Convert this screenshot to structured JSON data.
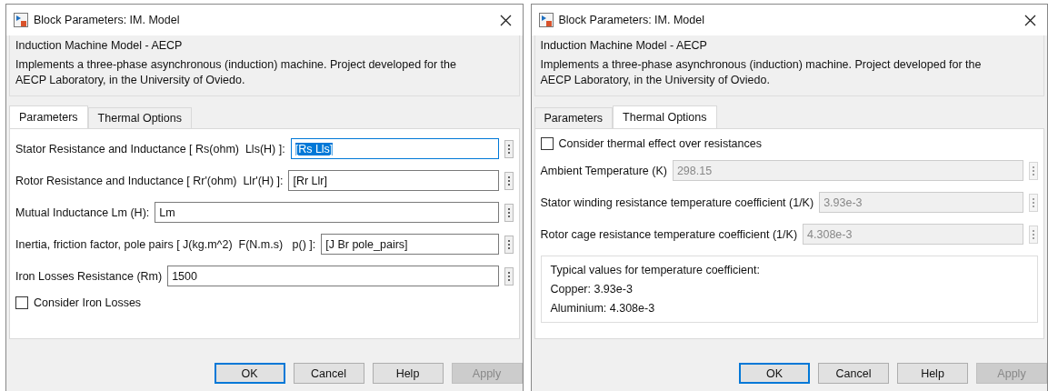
{
  "dialogs": [
    {
      "title": "Block Parameters: IM. Model",
      "group_title": "Induction Machine Model - AECP",
      "description": "Implements a three-phase asynchronous (induction) machine. Project developed for the AECP Laboratory, in the University of Oviedo.",
      "tabs": [
        {
          "label": "Parameters",
          "selected": true
        },
        {
          "label": "Thermal Options",
          "selected": false
        }
      ],
      "items": [
        {
          "kind": "field",
          "label": "Stator Resistance and Inductance [ Rs(ohm)  Lls(H) ]:",
          "value": "[Rs Lls]",
          "disabled": false,
          "focused": true
        },
        {
          "kind": "field",
          "label": "Rotor Resistance and Inductance [ Rr'(ohm)  Llr'(H) ]:",
          "value": "[Rr Llr]",
          "disabled": false,
          "focused": false
        },
        {
          "kind": "field",
          "label": "Mutual Inductance Lm (H):",
          "value": "Lm",
          "disabled": false,
          "focused": false
        },
        {
          "kind": "field",
          "label": "Inertia, friction factor, pole pairs [ J(kg.m^2)  F(N.m.s)   p() ]:",
          "value": "[J Br pole_pairs]",
          "disabled": false,
          "focused": false
        },
        {
          "kind": "field",
          "label": "Iron Losses Resistance (Rm)",
          "value": "1500",
          "disabled": false,
          "focused": false
        },
        {
          "kind": "checkbox",
          "label": "Consider Iron Losses",
          "checked": false
        }
      ],
      "buttons": [
        {
          "label": "OK",
          "disabled": false,
          "default": true
        },
        {
          "label": "Cancel",
          "disabled": false,
          "default": false
        },
        {
          "label": "Help",
          "disabled": false,
          "default": false
        },
        {
          "label": "Apply",
          "disabled": true,
          "default": false
        }
      ]
    },
    {
      "title": "Block Parameters: IM. Model",
      "group_title": "Induction Machine Model - AECP",
      "description": "Implements a three-phase asynchronous (induction) machine. Project developed for the AECP Laboratory, in the University of Oviedo.",
      "tabs": [
        {
          "label": "Parameters",
          "selected": false
        },
        {
          "label": "Thermal Options",
          "selected": true
        }
      ],
      "items": [
        {
          "kind": "checkbox",
          "label": "Consider thermal effect over resistances",
          "checked": false
        },
        {
          "kind": "field",
          "label": "Ambient Temperature (K)",
          "value": "298.15",
          "disabled": true,
          "focused": false
        },
        {
          "kind": "field",
          "label": "Stator winding resistance temperature coefficient (1/K)",
          "value": "3.93e-3",
          "disabled": true,
          "focused": false
        },
        {
          "kind": "field",
          "label": "Rotor cage resistance temperature coefficient (1/K)",
          "value": "4.308e-3",
          "disabled": true,
          "focused": false
        },
        {
          "kind": "note",
          "lines": [
            "Typical values for temperature coefficient:",
            "Copper: 3.93e-3",
            "Aluminium: 4.308e-3"
          ]
        }
      ],
      "buttons": [
        {
          "label": "OK",
          "disabled": false,
          "default": true
        },
        {
          "label": "Cancel",
          "disabled": false,
          "default": false
        },
        {
          "label": "Help",
          "disabled": false,
          "default": false
        },
        {
          "label": "Apply",
          "disabled": true,
          "default": false
        }
      ]
    }
  ]
}
